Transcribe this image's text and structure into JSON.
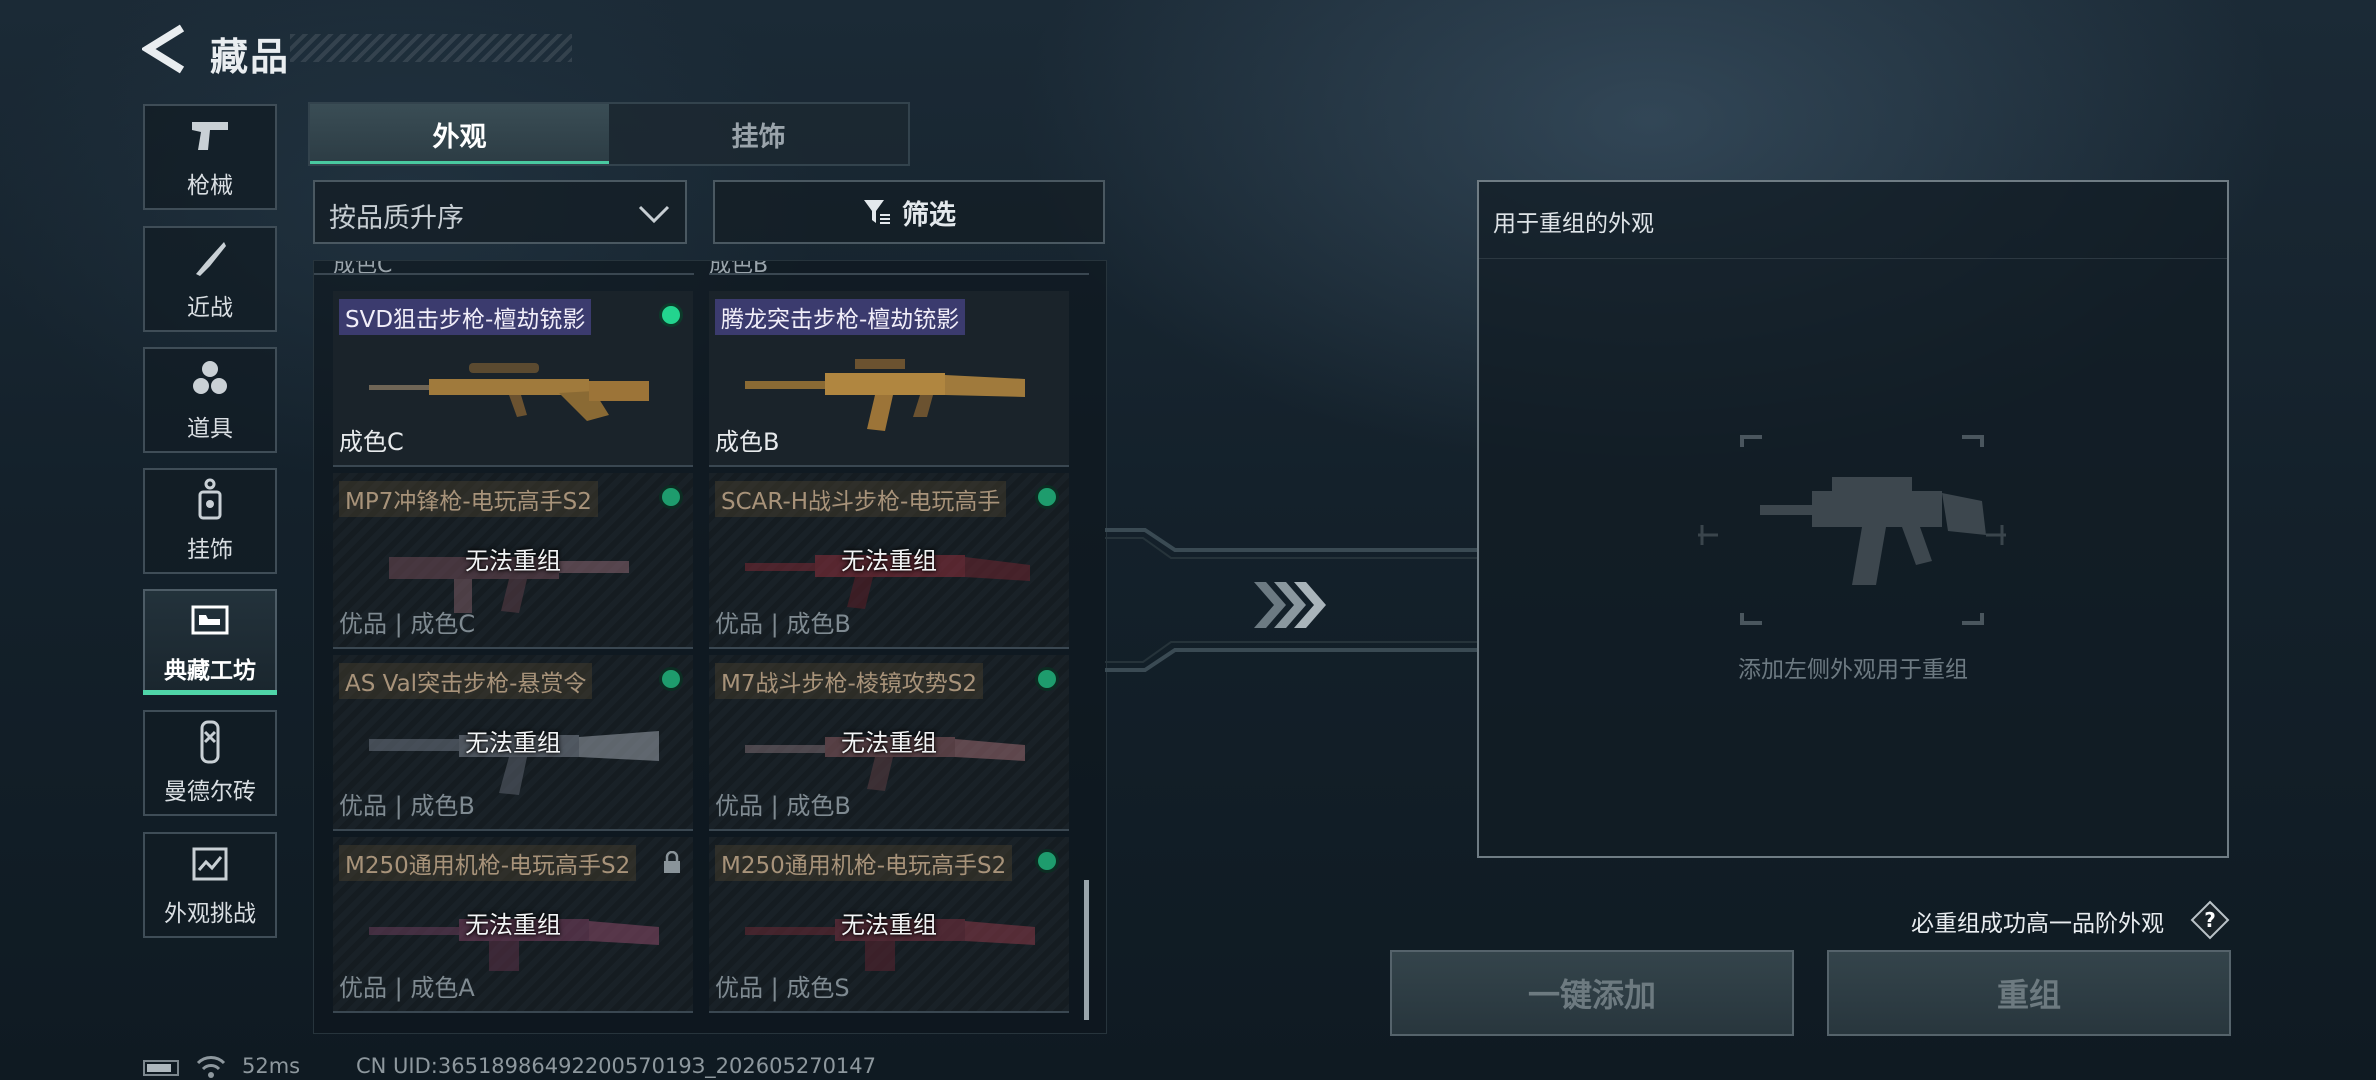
{
  "header": {
    "title": "藏品"
  },
  "nav": {
    "items": [
      {
        "label": "枪械",
        "icon": "pistol-icon"
      },
      {
        "label": "近战",
        "icon": "knife-icon"
      },
      {
        "label": "道具",
        "icon": "grenades-icon"
      },
      {
        "label": "挂饰",
        "icon": "charm-tag-icon"
      },
      {
        "label": "典藏工坊",
        "icon": "workshop-icon",
        "active": true
      },
      {
        "label": "曼德尔砖",
        "icon": "brick-icon"
      },
      {
        "label": "外观挑战",
        "icon": "map-challenge-icon"
      }
    ]
  },
  "tabs": [
    {
      "label": "外观",
      "active": true
    },
    {
      "label": "挂饰",
      "active": false
    }
  ],
  "sort": {
    "value": "按品质升序"
  },
  "filter": {
    "label": "筛选"
  },
  "list": {
    "partial_top": [
      "成色C",
      "成色B"
    ],
    "cards": [
      {
        "name": "SVD狙击步枪-檀劫铳影",
        "grade": "成色C",
        "overlay": "",
        "status": "owned",
        "available": true,
        "weapon_icon": "sniper-rifle-icon"
      },
      {
        "name": "腾龙突击步枪-檀劫铳影",
        "grade": "成色B",
        "overlay": "",
        "status": "none",
        "available": true,
        "weapon_icon": "assault-rifle-icon"
      },
      {
        "name": "MP7冲锋枪-电玩高手S2",
        "grade": "优品 | 成色C",
        "overlay": "无法重组",
        "status": "owned",
        "available": false,
        "weapon_icon": "smg-icon"
      },
      {
        "name": "SCAR-H战斗步枪-电玩高手",
        "grade": "优品 | 成色B",
        "overlay": "无法重组",
        "status": "owned",
        "available": false,
        "weapon_icon": "battle-rifle-icon"
      },
      {
        "name": "AS Val突击步枪-悬赏令",
        "grade": "优品 | 成色B",
        "overlay": "无法重组",
        "status": "owned",
        "available": false,
        "weapon_icon": "assault-rifle-icon"
      },
      {
        "name": "M7战斗步枪-棱镜攻势S2",
        "grade": "优品 | 成色B",
        "overlay": "无法重组",
        "status": "owned",
        "available": false,
        "weapon_icon": "battle-rifle-icon"
      },
      {
        "name": "M250通用机枪-电玩高手S2",
        "grade": "优品 | 成色A",
        "overlay": "无法重组",
        "status": "locked",
        "available": false,
        "weapon_icon": "machine-gun-icon"
      },
      {
        "name": "M250通用机枪-电玩高手S2",
        "grade": "优品 | 成色S",
        "overlay": "无法重组",
        "status": "owned",
        "available": false,
        "weapon_icon": "machine-gun-icon"
      }
    ]
  },
  "panel": {
    "title": "用于重组的外观",
    "hint": "添加左侧外观用于重组"
  },
  "guarantee": {
    "text": "必重组成功高一品阶外观",
    "help": "?"
  },
  "buttons": {
    "add": "一键添加",
    "recombine": "重组"
  },
  "status": {
    "ping": "52ms",
    "uid": "CN UID:3651898649220057019З_202605270147"
  },
  "colors": {
    "accent": "#4fd4a8",
    "owned_dot": "#23d48e",
    "highlight_name_bg": "#3b3b6e"
  }
}
